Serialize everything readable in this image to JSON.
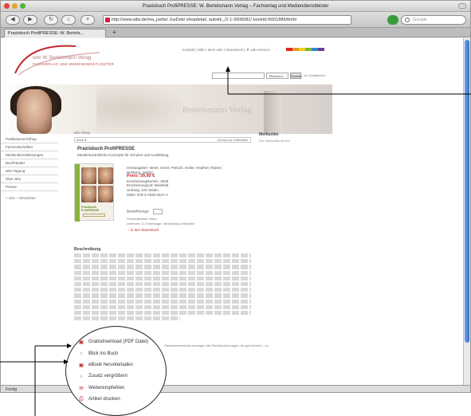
{
  "window": {
    "title": "Praxisbuch ProfiPRESSE: W. Bertelsmann Verlag – Fachverlag und Mediendienstleister",
    "url": "http://www.wbv.de/ma_jsetts/ JusDeb/ shopdetail. autotrk_/2-1-3006081/ bookId:/6001886/ttmhi",
    "search_placeholder": "Google",
    "tab_label": "Praxisbuch ProfiPRESSE: W. Bertels...",
    "status": "Fertig"
  },
  "site": {
    "logo_name": "wbv W. Bertelsmann Verlag",
    "logo_tagline": "FACHVERLAG UND MEDIENDIENSTLEISTER",
    "top_links": "Kontakt | Hilfe | Mein wbv | Warenkorb | ▼ wbv-Service",
    "colorbar": [
      "#e0262c",
      "#e69b24",
      "#f1d21b",
      "#7fb53a",
      "#2f8bd0",
      "#6d3d91"
    ],
    "search_select": "Titel/Autor",
    "search_button": "Suchen",
    "search_link": "zur Detailsuche",
    "banner_text": "Bertelsmann Verlag"
  },
  "sidebar": {
    "items": [
      "Publikationen/Shop",
      "Fachzeitschriften",
      "Mediendienstleistungen",
      "Buchhandel",
      "wbv-Tagung",
      "Über wbv",
      "Presse"
    ],
    "extra": "» wbv – Newsletter"
  },
  "product": {
    "breadcrumb": "wbv-Shop",
    "select_left": "Buch ▾",
    "select_right": "Zurück zur Trefferliste",
    "title": "Praxisbuch ProfiPRESSE",
    "subtitle": "Medienkontrollierte Konzepte für Schulen und Ausbildung",
    "cover_title": "Praxisbuch ProfiPRESSE",
    "details": [
      "Herausgeber: Meier, Gerrit; Pietsch, Heike; Hepfner, Rainer;",
      "Rehberg, Wolfrg.",
      "Preis: 39,90 €",
      "Erscheinungstermin: 2008",
      "Erscheinungsort: Bielefeld",
      "Umfang: 224 Seiten",
      "ISBN: 978-3-7639-3647-4"
    ],
    "qty_label": "Bestellmenge:",
    "ship_lines": [
      "Versandkosten: Mehr",
      "Lieferzeit: 3–5 Werktage / Bestellung verbindlich"
    ],
    "cart": "› in den Warenkorb",
    "brand_title": "Merkzettel",
    "brand_sub": "Der Merkzettel ist leer",
    "desc_heading": "Beschreibung",
    "after_text": "Gesamtverzeichnis anzeigen des Rechtsprechungen. Ihr gut Kunden – zu"
  },
  "magnifier": {
    "items": [
      {
        "icon": "pdf-icon",
        "glyph": "▣",
        "label": "Gratisdownload (PDF Datei)"
      },
      {
        "icon": "chevron-right-icon",
        "glyph": "›",
        "label": "Blick ins Buch"
      },
      {
        "icon": "pdf-icon",
        "glyph": "▣",
        "label": "eBook herunterladen"
      },
      {
        "icon": "chevron-right-icon",
        "glyph": "›",
        "label": "Zusatz vergrößern"
      },
      {
        "icon": "mail-icon",
        "glyph": "✉",
        "label": "Weiterempfehlen"
      },
      {
        "icon": "print-icon",
        "glyph": "⎙",
        "label": "Artikel drucken"
      }
    ]
  },
  "callouts": {
    "tagline_label": "",
    "download_label": "",
    "ebook_label": ""
  }
}
